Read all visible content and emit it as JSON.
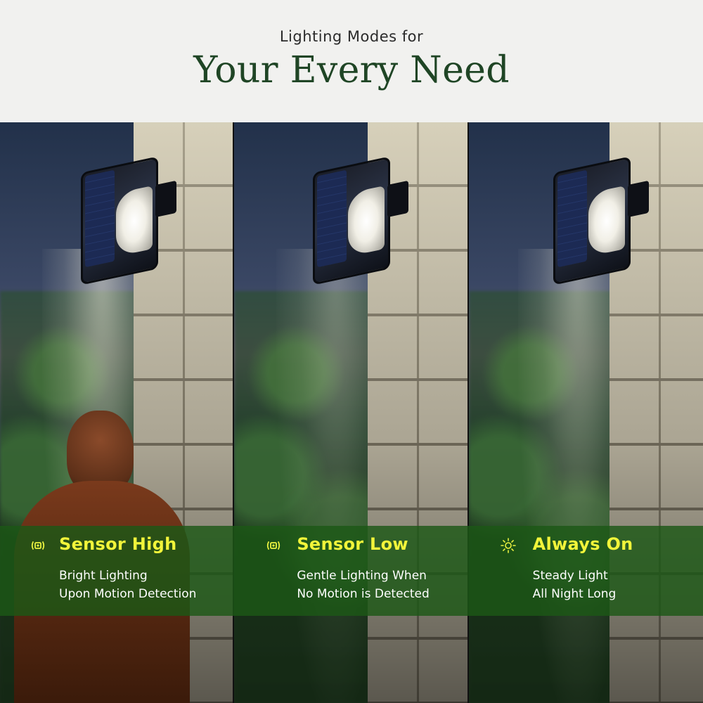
{
  "header": {
    "subtitle": "Lighting Modes for",
    "title": "Your Every Need"
  },
  "colors": {
    "title_green": "#1f4525",
    "band_green": "#1c5816",
    "mode_title_yellow": "#f2f53a"
  },
  "modes": [
    {
      "icon": "motion-sensor-icon",
      "title": "Sensor High",
      "description": "Bright Lighting\nUpon Motion Detection"
    },
    {
      "icon": "motion-sensor-icon",
      "title": "Sensor Low",
      "description": "Gentle Lighting When\nNo Motion is Detected"
    },
    {
      "icon": "sun-icon",
      "title": "Always On",
      "description": "Steady Light\nAll Night Long"
    }
  ]
}
